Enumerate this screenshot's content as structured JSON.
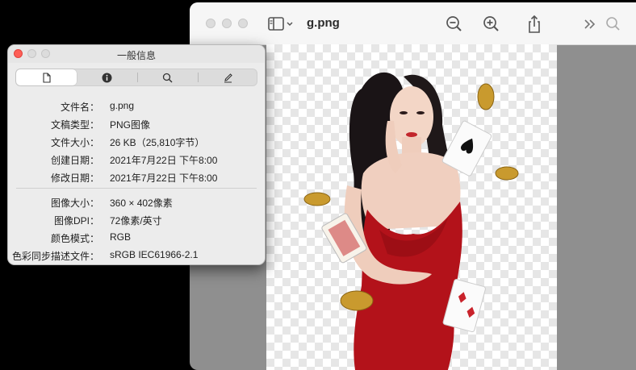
{
  "preview": {
    "title": "g.png",
    "toolbar": {
      "sidebar_icon": "sidebar-icon",
      "zoom_out_icon": "zoom-out-icon",
      "zoom_in_icon": "zoom-in-icon",
      "share_icon": "share-icon",
      "more_icon": "chevron-double-right-icon",
      "search_icon": "search-icon"
    }
  },
  "info": {
    "title": "一般信息",
    "tabs": [
      "general-icon",
      "info-icon",
      "search-icon",
      "edit-icon"
    ],
    "general": [
      {
        "label": "文件名：",
        "value": "g.png"
      },
      {
        "label": "文稿类型：",
        "value": "PNG图像"
      },
      {
        "label": "文件大小：",
        "value": "26 KB（25,810字节）"
      },
      {
        "label": "创建日期：",
        "value": "2021年7月22日 下午8:00"
      },
      {
        "label": "修改日期：",
        "value": "2021年7月22日 下午8:00"
      }
    ],
    "image": [
      {
        "label": "图像大小：",
        "value": "360 × 402像素"
      },
      {
        "label": "图像DPI：",
        "value": "72像素/英寸"
      },
      {
        "label": "颜色模式：",
        "value": "RGB"
      },
      {
        "label": "色彩同步描述文件：",
        "value": "sRGB IEC61966-2.1"
      }
    ]
  },
  "colors": {
    "close": "#fe5f57",
    "minimize": "#febc2e",
    "dress": "#b3121a"
  }
}
